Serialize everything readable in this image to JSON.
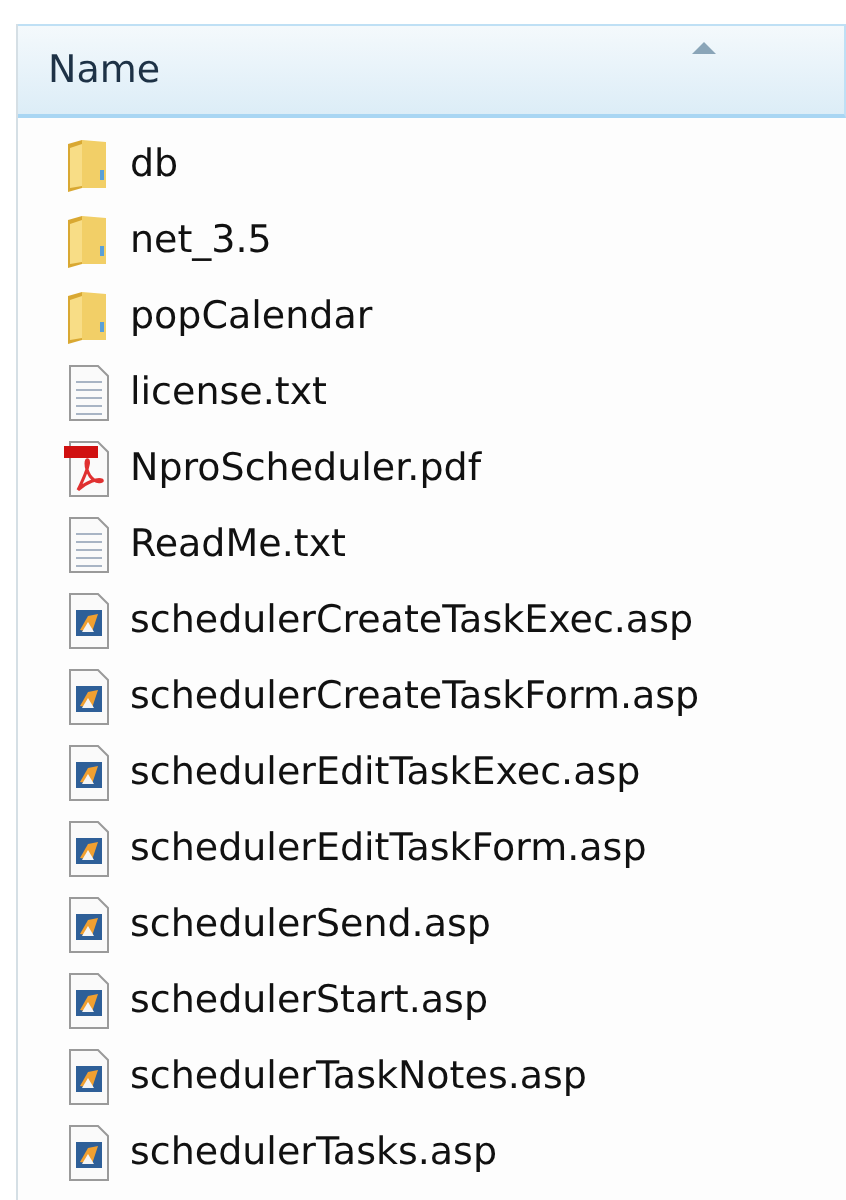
{
  "header": {
    "label": "Name",
    "sorted_ascending": true
  },
  "files": [
    {
      "name": "db",
      "kind": "folder"
    },
    {
      "name": "net_3.5",
      "kind": "folder"
    },
    {
      "name": "popCalendar",
      "kind": "folder"
    },
    {
      "name": "license.txt",
      "kind": "text"
    },
    {
      "name": "NproScheduler.pdf",
      "kind": "pdf"
    },
    {
      "name": "ReadMe.txt",
      "kind": "text"
    },
    {
      "name": "schedulerCreateTaskExec.asp",
      "kind": "asp"
    },
    {
      "name": "schedulerCreateTaskForm.asp",
      "kind": "asp"
    },
    {
      "name": "schedulerEditTaskExec.asp",
      "kind": "asp"
    },
    {
      "name": "schedulerEditTaskForm.asp",
      "kind": "asp"
    },
    {
      "name": "schedulerSend.asp",
      "kind": "asp"
    },
    {
      "name": "schedulerStart.asp",
      "kind": "asp"
    },
    {
      "name": "schedulerTaskNotes.asp",
      "kind": "asp"
    },
    {
      "name": "schedulerTasks.asp",
      "kind": "asp"
    }
  ]
}
